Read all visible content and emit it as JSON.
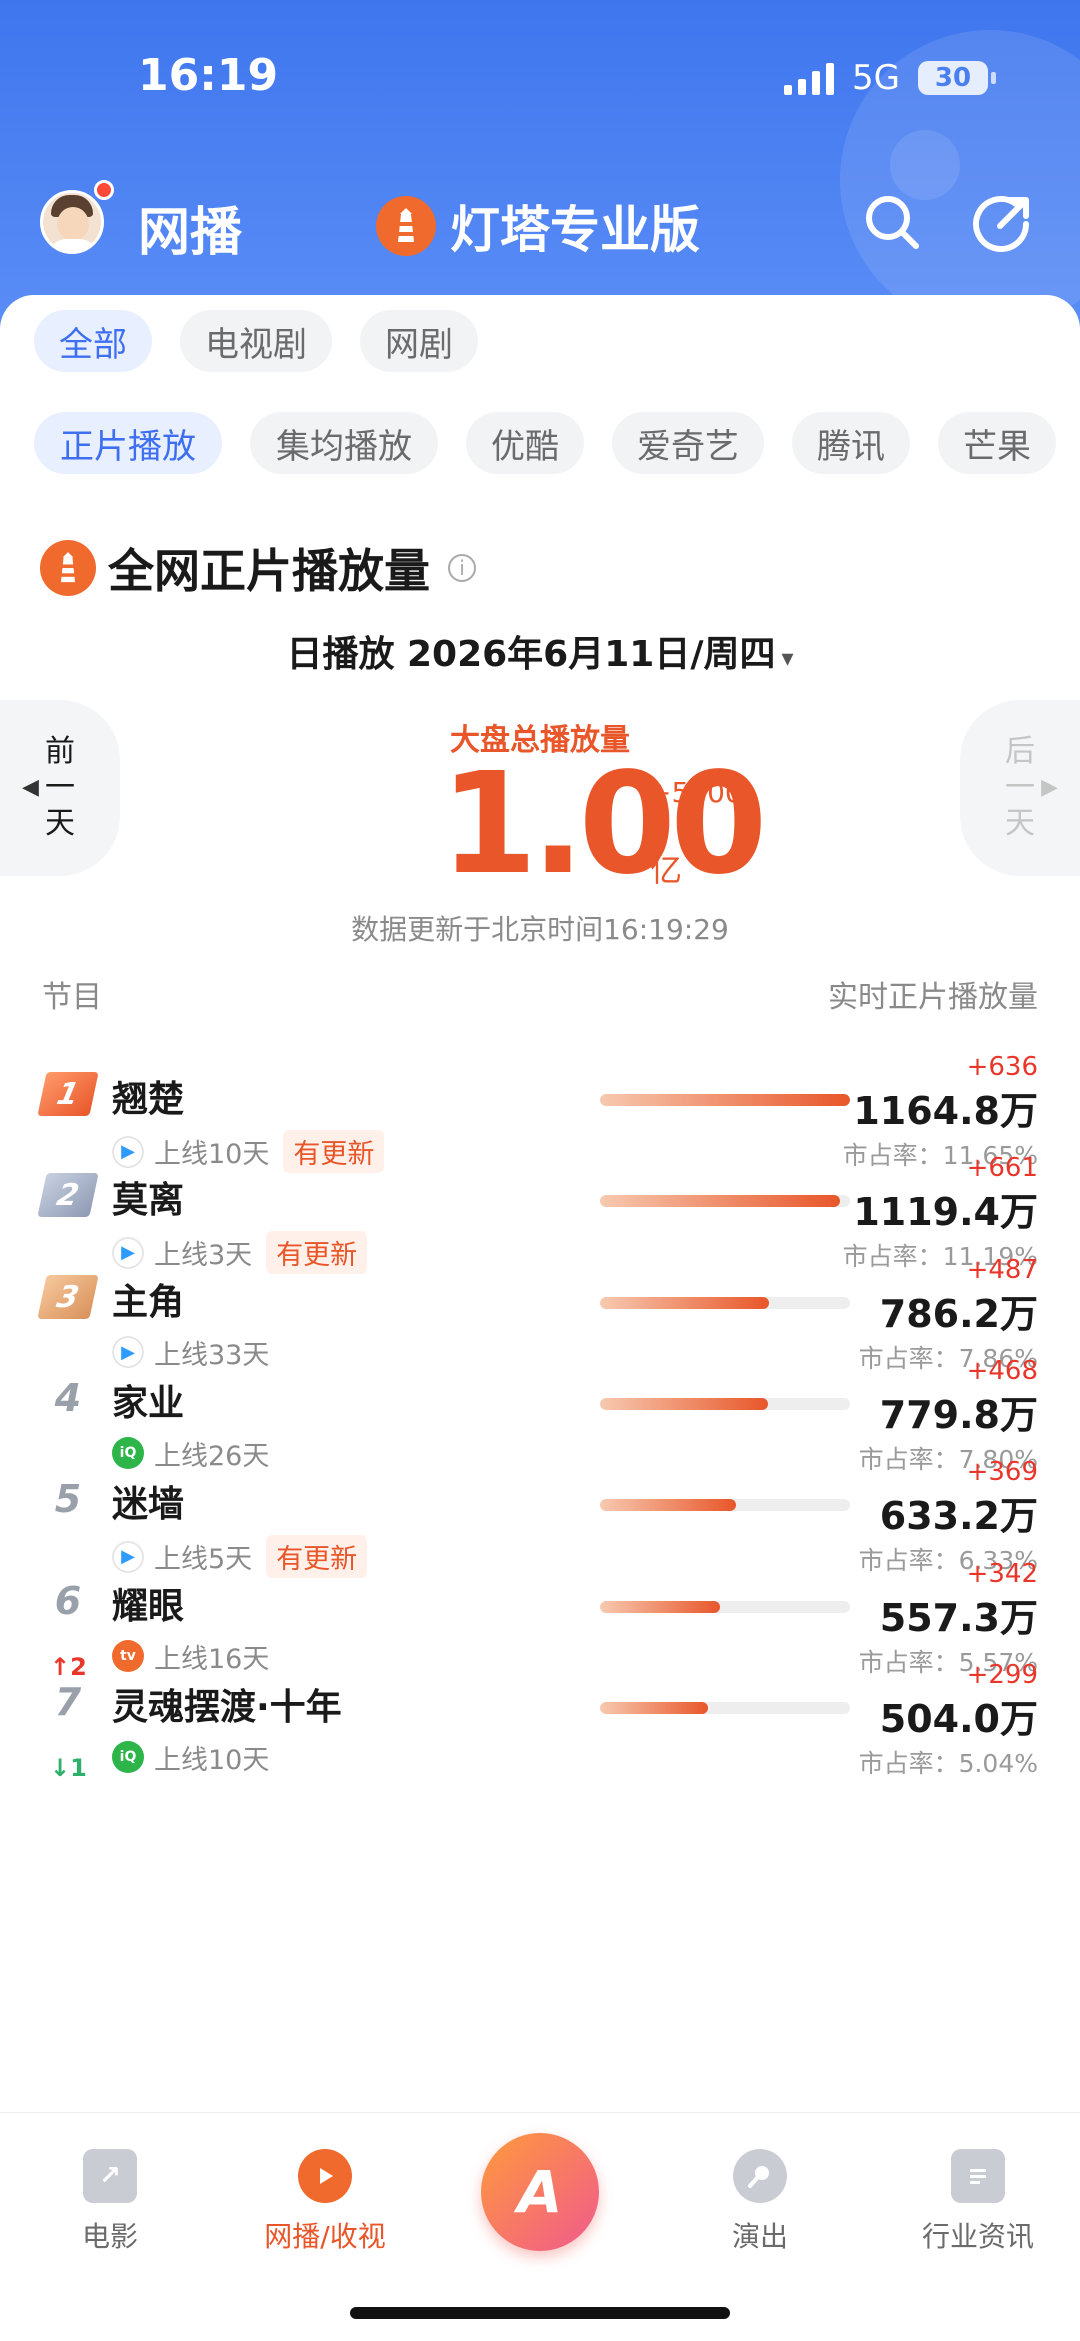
{
  "status": {
    "time": "16:19",
    "network": "5G",
    "battery": "30"
  },
  "header": {
    "left_title": "网播",
    "brand_title": "灯塔专业版"
  },
  "category_chips": [
    {
      "label": "全部",
      "active": true
    },
    {
      "label": "电视剧",
      "active": false
    },
    {
      "label": "网剧",
      "active": false
    }
  ],
  "source_chips": [
    {
      "label": "正片播放",
      "active": true
    },
    {
      "label": "集均播放",
      "active": false
    },
    {
      "label": "优酷",
      "active": false
    },
    {
      "label": "爱奇艺",
      "active": false
    },
    {
      "label": "腾讯",
      "active": false
    },
    {
      "label": "芒果",
      "active": false
    }
  ],
  "section": {
    "title": "全网正片播放量",
    "date_label": "日播放 2026年6月11日/周四",
    "caret": "▾"
  },
  "nav": {
    "prev": [
      "前",
      "一",
      "天"
    ],
    "next": [
      "后",
      "一",
      "天"
    ],
    "prev_arrow": "◀",
    "next_arrow": "▶"
  },
  "total": {
    "label": "大盘总播放量",
    "value": "1.00",
    "delta": "+5900",
    "unit": "亿",
    "updated": "数据更新于北京时间16:19:29"
  },
  "columns": {
    "left": "节目",
    "right": "实时正片播放量"
  },
  "rows": [
    {
      "rank": "1",
      "title": "翘楚",
      "platform": "tencent",
      "days": "上线10天",
      "tag": "有更新",
      "trend": "",
      "delta": "+636",
      "value": "1164.8万",
      "share": "市占率：11.65%",
      "bar": 1.0
    },
    {
      "rank": "2",
      "title": "莫离",
      "platform": "tencent",
      "days": "上线3天",
      "tag": "有更新",
      "trend": "",
      "delta": "+661",
      "value": "1119.4万",
      "share": "市占率：11.19%",
      "bar": 0.96
    },
    {
      "rank": "3",
      "title": "主角",
      "platform": "tencent",
      "days": "上线33天",
      "tag": "",
      "trend": "",
      "delta": "+487",
      "value": "786.2万",
      "share": "市占率：7.86%",
      "bar": 0.675
    },
    {
      "rank": "4",
      "title": "家业",
      "platform": "iqiyi",
      "days": "上线26天",
      "tag": "",
      "trend": "",
      "delta": "+468",
      "value": "779.8万",
      "share": "市占率：7.80%",
      "bar": 0.67
    },
    {
      "rank": "5",
      "title": "迷墙",
      "platform": "tencent",
      "days": "上线5天",
      "tag": "有更新",
      "trend": "",
      "delta": "+369",
      "value": "633.2万",
      "share": "市占率：6.33%",
      "bar": 0.544
    },
    {
      "rank": "6",
      "title": "耀眼",
      "platform": "mango",
      "days": "上线16天",
      "tag": "",
      "trend": "↑2",
      "delta": "+342",
      "value": "557.3万",
      "share": "市占率：5.57%",
      "bar": 0.478
    },
    {
      "rank": "7",
      "title": "灵魂摆渡·十年",
      "platform": "iqiyi",
      "days": "上线10天",
      "tag": "",
      "trend": "↓1",
      "delta": "+299",
      "value": "504.0万",
      "share": "市占率：5.04%",
      "bar": 0.433
    }
  ],
  "tabbar": {
    "movie": "电影",
    "web": "网播/收视",
    "show": "演出",
    "news": "行业资讯",
    "center": "A"
  },
  "colors": {
    "brand_blue": "#4a7ff0",
    "accent_orange": "#e8562a",
    "up_red": "#e8362a",
    "down_green": "#2eaf6a"
  }
}
